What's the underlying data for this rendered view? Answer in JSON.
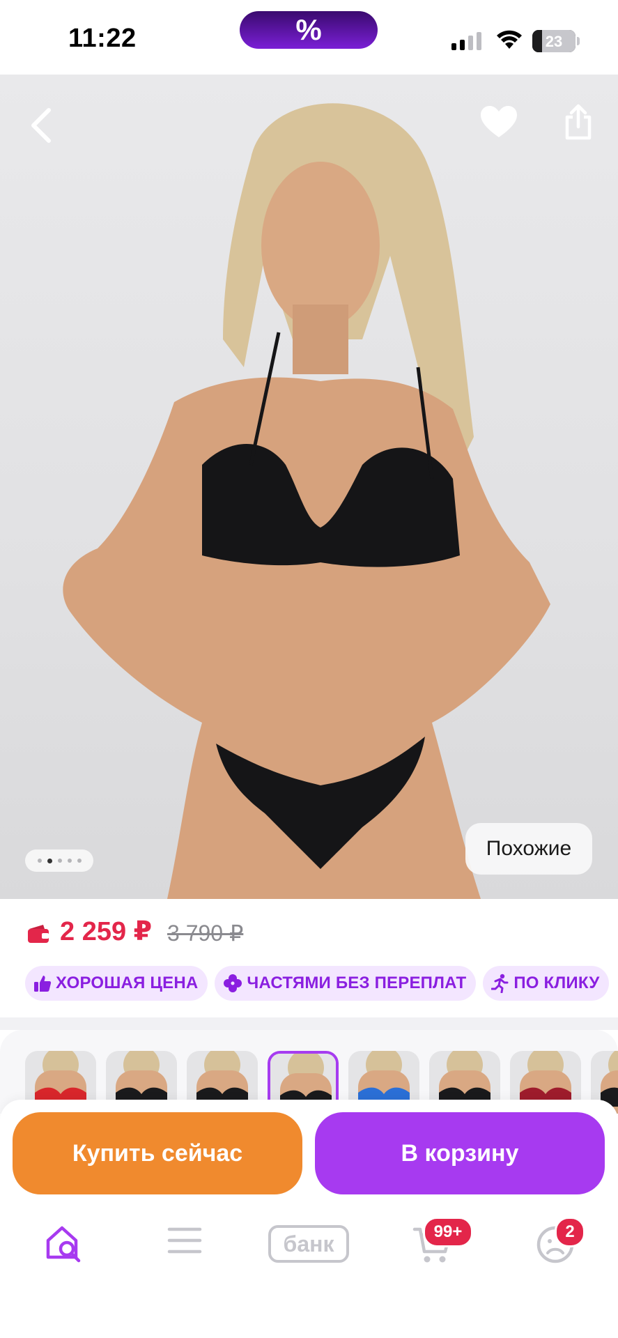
{
  "status_bar": {
    "time": "11:22",
    "promo_symbol": "%",
    "battery_level": "23"
  },
  "hero": {
    "similar_label": "Похожие",
    "gallery_index": 2,
    "gallery_count": 5
  },
  "price": {
    "current": "2 259 ₽",
    "old": "3 790 ₽",
    "color": "#e3264a"
  },
  "chips": [
    {
      "label": "ХОРОШАЯ ЦЕНА",
      "icon": "thumbs-up-icon"
    },
    {
      "label": "ЧАСТЯМИ БЕЗ ПЕРЕПЛАТ",
      "icon": "clover-icon"
    },
    {
      "label": "ПО КЛИКУ",
      "icon": "running-icon"
    }
  ],
  "variants": {
    "selected_index": 3,
    "swatches": [
      "red",
      "black",
      "black",
      "black",
      "blue",
      "black",
      "burgundy",
      "black"
    ]
  },
  "actions": {
    "buy_now": "Купить сейчас",
    "add_to_cart": "В корзину",
    "buy_color": "#f08a2e",
    "cart_color": "#a73af0"
  },
  "nav": {
    "bank_label": "банк",
    "cart_badge": "99+",
    "profile_badge": "2",
    "accent": "#a73af0"
  }
}
